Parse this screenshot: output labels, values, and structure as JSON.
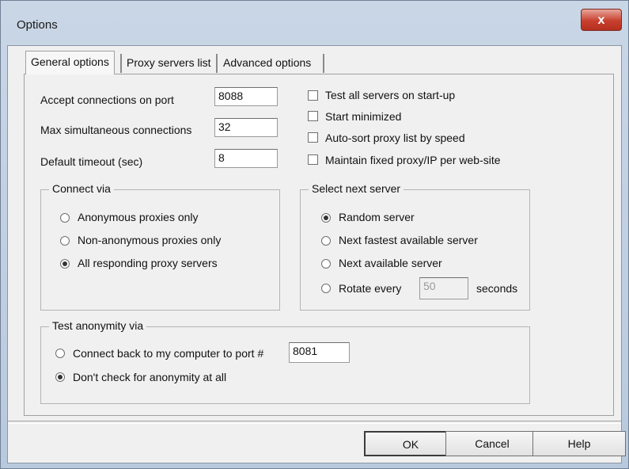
{
  "window": {
    "title": "Options",
    "close_label": "x"
  },
  "tabs": [
    {
      "label": "General options"
    },
    {
      "label": "Proxy servers list"
    },
    {
      "label": "Advanced options"
    }
  ],
  "general": {
    "port_label": "Accept connections on port",
    "port_value": "8088",
    "max_conn_label": "Max simultaneous connections",
    "max_conn_value": "32",
    "timeout_label": "Default timeout (sec)",
    "timeout_value": "8",
    "checkboxes": [
      {
        "label": "Test all servers on start-up",
        "checked": false
      },
      {
        "label": "Start minimized",
        "checked": false
      },
      {
        "label": "Auto-sort proxy list by speed",
        "checked": false
      },
      {
        "label": "Maintain fixed proxy/IP per web-site",
        "checked": false
      }
    ]
  },
  "connect_via": {
    "title": "Connect via",
    "options": [
      {
        "label": "Anonymous proxies only",
        "checked": false
      },
      {
        "label": "Non-anonymous proxies only",
        "checked": false
      },
      {
        "label": "All responding proxy servers",
        "checked": true
      }
    ]
  },
  "select_next": {
    "title": "Select next server",
    "options": [
      {
        "label": "Random server",
        "checked": true
      },
      {
        "label": "Next fastest available server",
        "checked": false
      },
      {
        "label": "Next available server",
        "checked": false
      },
      {
        "label": "Rotate every",
        "checked": false
      }
    ],
    "rotate_value": "50",
    "rotate_unit": "seconds"
  },
  "anonymity": {
    "title": "Test anonymity via",
    "connect_back_label": "Connect back to my computer to port #",
    "connect_back_value": "8081",
    "connect_back_checked": false,
    "dont_check_label": "Don't check for anonymity at all",
    "dont_check_checked": true
  },
  "buttons": {
    "ok": "OK",
    "cancel": "Cancel",
    "help": "Help"
  }
}
